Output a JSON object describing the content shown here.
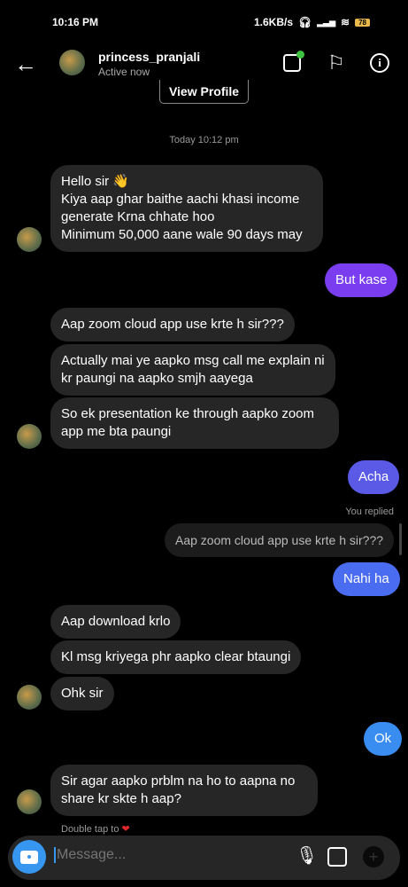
{
  "status_bar": {
    "time": "10:16 PM",
    "speed": "1.6KB/s",
    "battery": "78"
  },
  "header": {
    "username": "princess_pranjali",
    "status": "Active now",
    "view_profile": "View Profile"
  },
  "timestamp": "Today 10:12 pm",
  "messages": [
    {
      "from": "them",
      "text": "Hello sir 👋\nKiya aap ghar baithe aachi khasi income generate Krna chhate hoo\nMinimum 50,000 aane wale 90 days may"
    },
    {
      "from": "me",
      "text": "But kase"
    },
    {
      "from": "them",
      "text": "Aap zoom cloud app use krte h sir???"
    },
    {
      "from": "them",
      "text": "Actually mai ye aapko msg call me explain ni kr paungi na aapko smjh aayega"
    },
    {
      "from": "them",
      "text": "So ek presentation ke through aapko zoom app me bta paungi"
    },
    {
      "from": "me",
      "text": "Acha"
    },
    {
      "from": "me",
      "reply_label": "You replied",
      "quoted": "Aap zoom cloud app use krte h sir???"
    },
    {
      "from": "me",
      "text": "Nahi ha"
    },
    {
      "from": "them",
      "text": "Aap download krlo"
    },
    {
      "from": "them",
      "text": "Kl msg kriyega phr aapko clear btaungi"
    },
    {
      "from": "them",
      "text": "Ohk sir"
    },
    {
      "from": "me",
      "text": "Ok"
    },
    {
      "from": "them",
      "text": "Sir agar aapko prblm na ho to aapna no share kr skte h aap?"
    }
  ],
  "hint": "Double tap to",
  "composer": {
    "placeholder": "Message..."
  },
  "colors": {
    "received": "#262626",
    "sent_purple": "#7a3ef0",
    "sent_indigo": "#5a5ae6",
    "sent_blue": "#4a6cf0",
    "sent_light_blue": "#3a8df0",
    "camera": "#3797f0"
  }
}
